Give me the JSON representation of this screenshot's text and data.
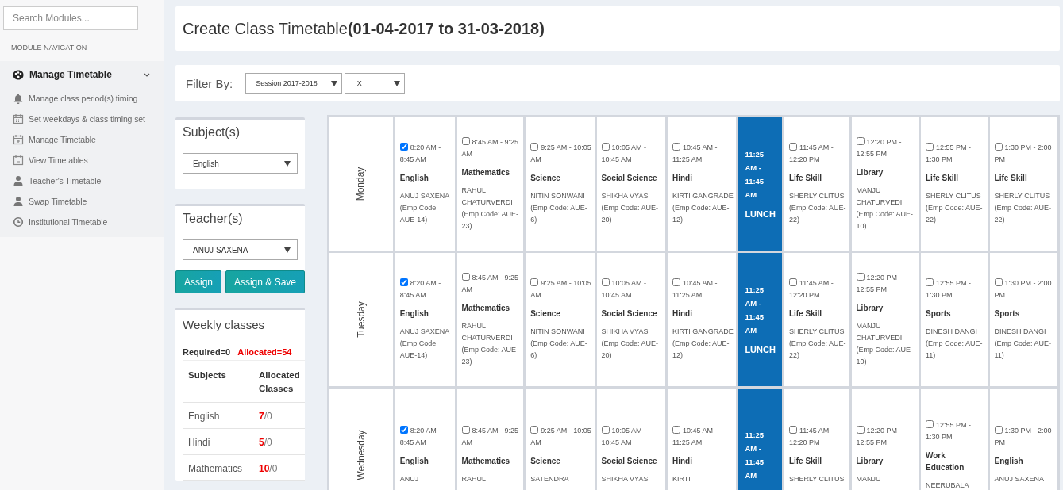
{
  "sidebar": {
    "search": {
      "placeholder": "Search Modules..."
    },
    "section_title": "MODULE NAVIGATION",
    "group": {
      "label": "Manage Timetable",
      "expanded": true,
      "items": [
        {
          "label": "Manage class period(s) timing"
        },
        {
          "label": "Set weekdays & class timing set"
        },
        {
          "label": "Manage Timetable"
        },
        {
          "label": "View Timetables"
        },
        {
          "label": "Teacher's Timetable"
        },
        {
          "label": "Swap Timetable"
        },
        {
          "label": "Institutional Timetable"
        }
      ]
    }
  },
  "header": {
    "title": "Create Class Timetable**(01-04-2017 to 31-03-2018)**"
  },
  "filter": {
    "label": "Filter By:",
    "session": "Session 2017-2018",
    "class": "IX"
  },
  "subject_panel": {
    "title": "Subject(s)",
    "value": "English"
  },
  "teacher_panel": {
    "title": "Teacher(s)",
    "value": "ANUJ SAXENA"
  },
  "buttons": [
    "Assign",
    "Assign & Save"
  ],
  "weekly": {
    "title": "Weekly classes",
    "required": "Required=0",
    "allocated": "Allocated=54",
    "columns": [
      "Subjects",
      "Allocated Classes"
    ],
    "rows": [
      {
        "subject": "English",
        "allocated": "7",
        "suffix": "/0"
      },
      {
        "subject": "Hindi",
        "allocated": "5",
        "suffix": "/0"
      },
      {
        "subject": "Mathematics",
        "allocated": "10",
        "suffix": "/0"
      }
    ]
  },
  "timetable": [
    {
      "day": "Monday",
      "cells": [
        {
          "kind": "period",
          "checked": true,
          "time": "8:20 AM - 8:45 AM",
          "subject": "English",
          "teacher": "ANUJ SAXENA (Emp Code: AUE-14)"
        },
        {
          "kind": "period",
          "checked": false,
          "time": "8:45 AM - 9:25 AM",
          "subject": "Mathematics",
          "teacher": "RAHUL CHATURVERDI (Emp Code: AUE-23)"
        },
        {
          "kind": "period",
          "checked": false,
          "time": "9:25 AM - 10:05 AM",
          "subject": "Science",
          "teacher": "NITIN SONWANI (Emp Code: AUE-6)"
        },
        {
          "kind": "period",
          "checked": false,
          "time": "10:05 AM - 10:45 AM",
          "subject": "Social Science",
          "teacher": "SHIKHA VYAS (Emp Code: AUE-20)"
        },
        {
          "kind": "period",
          "checked": false,
          "time": "10:45 AM - 11:25 AM",
          "subject": "Hindi",
          "teacher": "KIRTI GANGRADE (Emp Code: AUE-12)"
        },
        {
          "kind": "lunch",
          "time": "11:25 AM - 11:45 AM",
          "label": "LUNCH"
        },
        {
          "kind": "period",
          "checked": false,
          "time": "11:45 AM - 12:20 PM",
          "subject": "Life Skill",
          "teacher": "SHERLY CLITUS (Emp Code: AUE-22)"
        },
        {
          "kind": "period",
          "checked": false,
          "time": "12:20 PM - 12:55 PM",
          "subject": "Library",
          "teacher": "MANJU CHATURVEDI (Emp Code: AUE-10)"
        },
        {
          "kind": "period",
          "checked": false,
          "time": "12:55 PM - 1:30 PM",
          "subject": "Life Skill",
          "teacher": "SHERLY CLITUS (Emp Code: AUE-22)"
        },
        {
          "kind": "period",
          "checked": false,
          "time": "1:30 PM - 2:00 PM",
          "subject": "Life Skill",
          "teacher": "SHERLY CLITUS (Emp Code: AUE-22)"
        }
      ]
    },
    {
      "day": "Tuesday",
      "cells": [
        {
          "kind": "period",
          "checked": true,
          "time": "8:20 AM - 8:45 AM",
          "subject": "English",
          "teacher": "ANUJ SAXENA (Emp Code: AUE-14)"
        },
        {
          "kind": "period",
          "checked": false,
          "time": "8:45 AM - 9:25 AM",
          "subject": "Mathematics",
          "teacher": "RAHUL CHATURVERDI (Emp Code: AUE-23)"
        },
        {
          "kind": "period",
          "checked": false,
          "time": "9:25 AM - 10:05 AM",
          "subject": "Science",
          "teacher": "NITIN SONWANI (Emp Code: AUE-6)"
        },
        {
          "kind": "period",
          "checked": false,
          "time": "10:05 AM - 10:45 AM",
          "subject": "Social Science",
          "teacher": "SHIKHA VYAS (Emp Code: AUE-20)"
        },
        {
          "kind": "period",
          "checked": false,
          "time": "10:45 AM - 11:25 AM",
          "subject": "Hindi",
          "teacher": "KIRTI GANGRADE (Emp Code: AUE-12)"
        },
        {
          "kind": "lunch",
          "time": "11:25 AM - 11:45 AM",
          "label": "LUNCH"
        },
        {
          "kind": "period",
          "checked": false,
          "time": "11:45 AM - 12:20 PM",
          "subject": "Life Skill",
          "teacher": "SHERLY CLITUS (Emp Code: AUE-22)"
        },
        {
          "kind": "period",
          "checked": false,
          "time": "12:20 PM - 12:55 PM",
          "subject": "Library",
          "teacher": "MANJU CHATURVEDI (Emp Code: AUE-10)"
        },
        {
          "kind": "period",
          "checked": false,
          "time": "12:55 PM - 1:30 PM",
          "subject": "Sports",
          "teacher": "DINESH DANGI (Emp Code: AUE-11)"
        },
        {
          "kind": "period",
          "checked": false,
          "time": "1:30 PM - 2:00 PM",
          "subject": "Sports",
          "teacher": "DINESH DANGI (Emp Code: AUE-11)"
        }
      ]
    },
    {
      "day": "Wednesday",
      "cells": [
        {
          "kind": "period",
          "checked": true,
          "time": "8:20 AM - 8:45 AM",
          "subject": "English",
          "teacher": "ANUJ"
        },
        {
          "kind": "period",
          "checked": false,
          "time": "8:45 AM - 9:25 AM",
          "subject": "Mathematics",
          "teacher": "RAHUL"
        },
        {
          "kind": "period",
          "checked": false,
          "time": "9:25 AM - 10:05 AM",
          "subject": "Science",
          "teacher": "SATENDRA"
        },
        {
          "kind": "period",
          "checked": false,
          "time": "10:05 AM - 10:45 AM",
          "subject": "Social Science",
          "teacher": "SHIKHA VYAS"
        },
        {
          "kind": "period",
          "checked": false,
          "time": "10:45 AM - 11:25 AM",
          "subject": "Hindi",
          "teacher": "KIRTI"
        },
        {
          "kind": "lunch",
          "time": "11:25 AM - 11:45 AM"
        },
        {
          "kind": "period",
          "checked": false,
          "time": "11:45 AM - 12:20 PM",
          "subject": "Life Skill",
          "teacher": "SHERLY CLITUS"
        },
        {
          "kind": "period",
          "checked": false,
          "time": "12:20 PM - 12:55 PM",
          "subject": "Library",
          "teacher": "MANJU"
        },
        {
          "kind": "period",
          "checked": false,
          "time": "12:55 PM - 1:30 PM",
          "subject": "Work Education",
          "teacher": "NEERUBALA"
        },
        {
          "kind": "period",
          "checked": false,
          "time": "1:30 PM - 2:00 PM",
          "subject": "English",
          "teacher": "ANUJ SAXENA"
        }
      ]
    }
  ]
}
